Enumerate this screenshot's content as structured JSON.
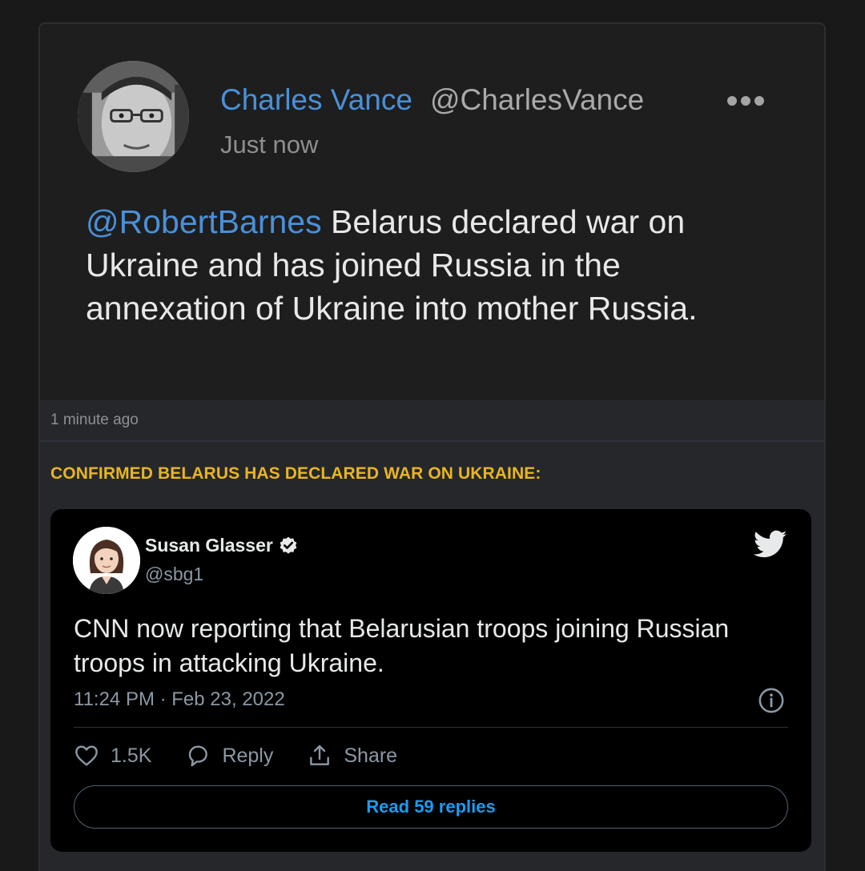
{
  "post": {
    "author_name": "Charles Vance",
    "author_handle": "@CharlesVance",
    "time": "Just now",
    "mention": "@RobertBarnes",
    "text": " Belarus declared war on Ukraine and has joined Russia in the annexation of Ukraine into mother Russia."
  },
  "embed": {
    "time": "1 minute ago",
    "headline": "CONFIRMED BELARUS HAS DECLARED WAR ON UKRAINE:",
    "tweet": {
      "name": "Susan Glasser",
      "handle": "@sbg1",
      "text": "CNN now reporting that Belarusian troops joining Russian troops in attacking Ukraine.",
      "date": "11:24 PM · Feb 23, 2022",
      "likes": "1.5K",
      "reply_label": "Reply",
      "share_label": "Share",
      "read_replies_label": "Read 59 replies"
    }
  },
  "colors": {
    "link_blue": "#4a90d9",
    "headline_gold": "#e9b521",
    "twitter_blue": "#1d9bf0"
  },
  "icons": [
    "more-icon",
    "verified-icon",
    "twitter-bird-icon",
    "info-icon",
    "heart-icon",
    "reply-bubble-icon",
    "share-icon"
  ]
}
